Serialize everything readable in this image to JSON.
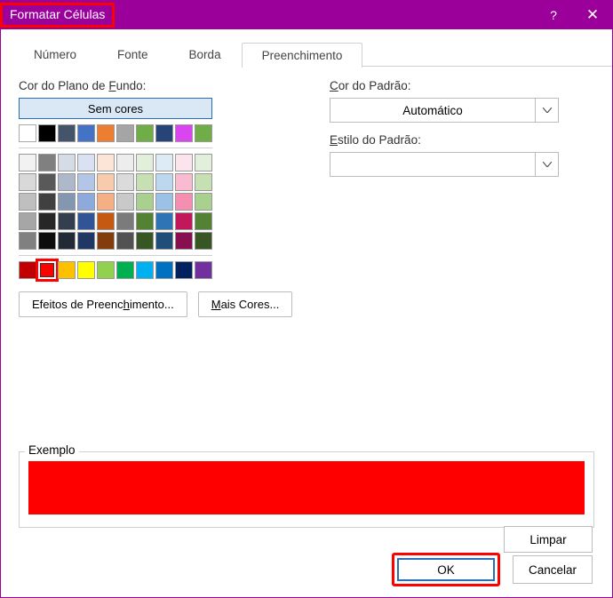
{
  "titlebar": {
    "title": "Formatar Células",
    "help": "?",
    "close": "✕"
  },
  "tabs": {
    "t1": "Número",
    "t2": "Fonte",
    "t3": "Borda",
    "t4": "Preenchimento"
  },
  "left": {
    "bg_label_pre": "Cor do Plano de ",
    "bg_label_ul": "F",
    "bg_label_post": "undo:",
    "no_color": "Sem cores",
    "fill_effects_pre": "Efeitos de Preenc",
    "fill_effects_ul": "h",
    "fill_effects_post": "imento...",
    "more_colors_ul": "M",
    "more_colors_post": "ais Cores..."
  },
  "right": {
    "pattern_color_ul": "C",
    "pattern_color_post": "or do Padrão:",
    "auto": "Automático",
    "pattern_style_ul": "E",
    "pattern_style_post": "stilo do Padrão:"
  },
  "example": {
    "label": "Exemplo",
    "color": "#ff0000"
  },
  "footer": {
    "clear": "Limpar",
    "ok": "OK",
    "cancel": "Cancelar"
  },
  "palette": {
    "row1": [
      "#ffffff",
      "#000000",
      "#44546a",
      "#4472c4",
      "#ed7d31",
      "#a5a5a5",
      "#70ad47",
      "#264478",
      "#d946ef",
      "#70ad47"
    ],
    "theme": [
      [
        "#f2f2f2",
        "#808080",
        "#d6dce5",
        "#d9e1f2",
        "#fce4d6",
        "#ededed",
        "#e2efda",
        "#ddebf7",
        "#fce4ec",
        "#e2efda"
      ],
      [
        "#d9d9d9",
        "#595959",
        "#adb9ca",
        "#b4c6e7",
        "#f8cbad",
        "#dbdbdb",
        "#c6e0b4",
        "#bdd7ee",
        "#f8bbd0",
        "#c6e0b4"
      ],
      [
        "#bfbfbf",
        "#404040",
        "#8497b0",
        "#8ea9db",
        "#f4b084",
        "#c9c9c9",
        "#a9d08e",
        "#9bc2e6",
        "#f48fb1",
        "#a9d08e"
      ],
      [
        "#a6a6a6",
        "#262626",
        "#333f4f",
        "#305496",
        "#c65911",
        "#7b7b7b",
        "#548235",
        "#2f75b5",
        "#c2185b",
        "#548235"
      ],
      [
        "#808080",
        "#0d0d0d",
        "#222b35",
        "#203764",
        "#833c0c",
        "#525252",
        "#375623",
        "#1f4e78",
        "#880e4f",
        "#375623"
      ]
    ],
    "standard": [
      "#c00000",
      "#ff0000",
      "#ffc000",
      "#ffff00",
      "#92d050",
      "#00b050",
      "#00b0f0",
      "#0070c0",
      "#002060",
      "#7030a0"
    ],
    "selected": 1
  }
}
